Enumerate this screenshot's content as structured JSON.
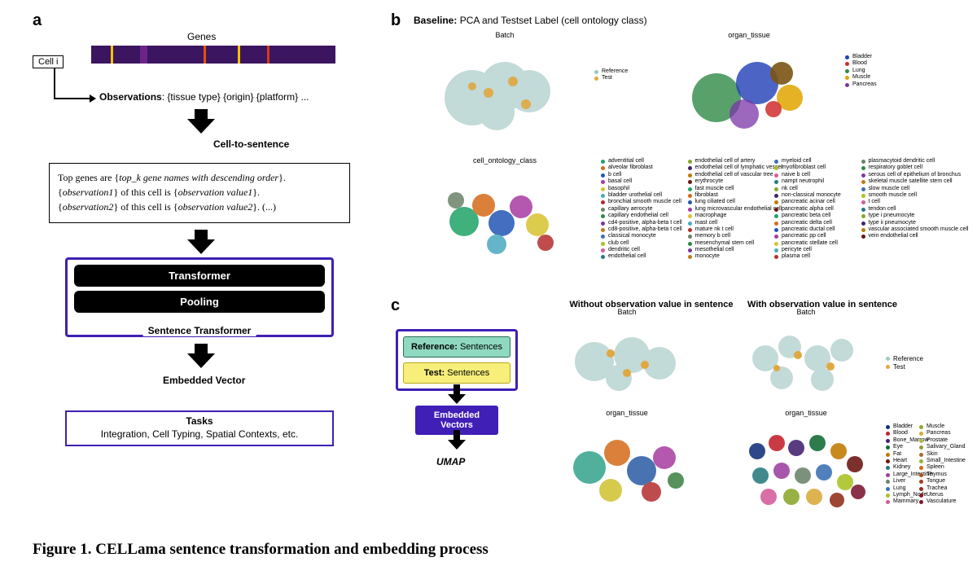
{
  "panelA": {
    "label": "a",
    "genes_heading": "Genes",
    "cell_label": "Cell i",
    "observations_line": "Observations: {tissue type} {origin} {platform} ...",
    "c2s_label": "Cell-to-sentence",
    "sentence_line1": "Top genes are {top_k gene names with descending order}.",
    "sentence_line2": "{observation1} of this cell is {observation value1}.",
    "sentence_line3": "{observation2} of this cell is {observation value2}. (...)",
    "transformer": "Transformer",
    "pooling": "Pooling",
    "sentence_transformer": "Sentence Transformer",
    "embedded_vector": "Embedded Vector",
    "tasks_title": "Tasks",
    "tasks_body": "Integration, Cell Typing, Spatial Contexts, etc."
  },
  "panelB": {
    "label": "b",
    "title_prefix": "Baseline:",
    "title_rest": " PCA and Testset Label (cell ontology class)",
    "plot_batch": "Batch",
    "plot_organ": "organ_tissue",
    "plot_ontology": "cell_ontology_class",
    "legend_batch": [
      "Reference",
      "Test"
    ],
    "legend_organ": [
      "Bladder",
      "Blood",
      "Lung",
      "Muscle",
      "Pancreas"
    ],
    "legend_organ_colors": [
      "#1f3fb5",
      "#d02d2d",
      "#2e8a46",
      "#e1a400",
      "#7a36a8"
    ],
    "legend_ontology": [
      "adventitial cell",
      "alveolar fibroblast",
      "b cell",
      "basal cell",
      "basophil",
      "bladder urothelial cell",
      "bronchial smooth muscle cell",
      "capillary aerocyte",
      "capillary endothelial cell",
      "cd4-positive, alpha-beta t cell",
      "cd8-positive, alpha-beta t cell",
      "classical monocyte",
      "club cell",
      "dendritic cell",
      "endothelial cell",
      "endothelial cell of artery",
      "endothelial cell of lymphatic vessel",
      "endothelial cell of vascular tree",
      "erythrocyte",
      "fast muscle cell",
      "fibroblast",
      "lung ciliated cell",
      "lung microvascular endothelial cell",
      "macrophage",
      "mast cell",
      "mature nk t cell",
      "memory b cell",
      "mesenchymal stem cell",
      "mesothelial cell",
      "monocyte",
      "myeloid cell",
      "myofibroblast cell",
      "naive b cell",
      "nampt neutrophil",
      "nk cell",
      "non-classical monocyte",
      "pancreatic acinar cell",
      "pancreatic alpha cell",
      "pancreatic beta cell",
      "pancreatic delta cell",
      "pancreatic ductal cell",
      "pancreatic pp cell",
      "pancreatic stellate cell",
      "pericyte cell",
      "plasma cell",
      "plasmacytoid dendritic cell",
      "respiratory goblet cell",
      "serous cell of epithelium of bronchus",
      "skeletal muscle satellite stem cell",
      "slow muscle cell",
      "smooth muscle cell",
      "t cell",
      "tendon cell",
      "type i pneumocyte",
      "type ii pneumocyte",
      "vascular associated smooth muscle cell",
      "vein endothelial cell"
    ]
  },
  "panelC": {
    "label": "c",
    "ref_line": "Reference: Sentences",
    "test_line": "Test: Sentences",
    "embed_box": "Embedded Vectors",
    "umap": "UMAP",
    "col1_title": "Without observation value in sentence",
    "col2_title": "With observation value in sentence",
    "plot_batch": "Batch",
    "plot_organ": "organ_tissue",
    "legend_batch": [
      "Reference",
      "Test"
    ],
    "legend_organ": [
      "Bladder",
      "Blood",
      "Bone_Marrow",
      "Eye",
      "Fat",
      "Heart",
      "Kidney",
      "Large_Intestine",
      "Liver",
      "Lung",
      "Lymph_Node",
      "Mammary",
      "Muscle",
      "Pancreas",
      "Prostate",
      "Salivary_Gland",
      "Skin",
      "Small_Intestine",
      "Spleen",
      "Thymus",
      "Tongue",
      "Trachea",
      "Uterus",
      "Vasculature"
    ],
    "legend_organ_colors": [
      "#11317a",
      "#c1202b",
      "#43226f",
      "#0f6b34",
      "#bf7a00",
      "#6b1410",
      "#267a7f",
      "#9d3fa0",
      "#6b826b",
      "#3a6fb5",
      "#a9c222",
      "#d55b9a",
      "#8aa72e",
      "#d9a93a",
      "#b2b740",
      "#929c3e",
      "#a86b2e",
      "#8fb53a",
      "#cf6a1a",
      "#b34f16",
      "#a83c1e",
      "#8f2d18",
      "#8a1d22",
      "#7b1530"
    ]
  },
  "caption": "Figure 1. CELLama sentence transformation and embedding process"
}
